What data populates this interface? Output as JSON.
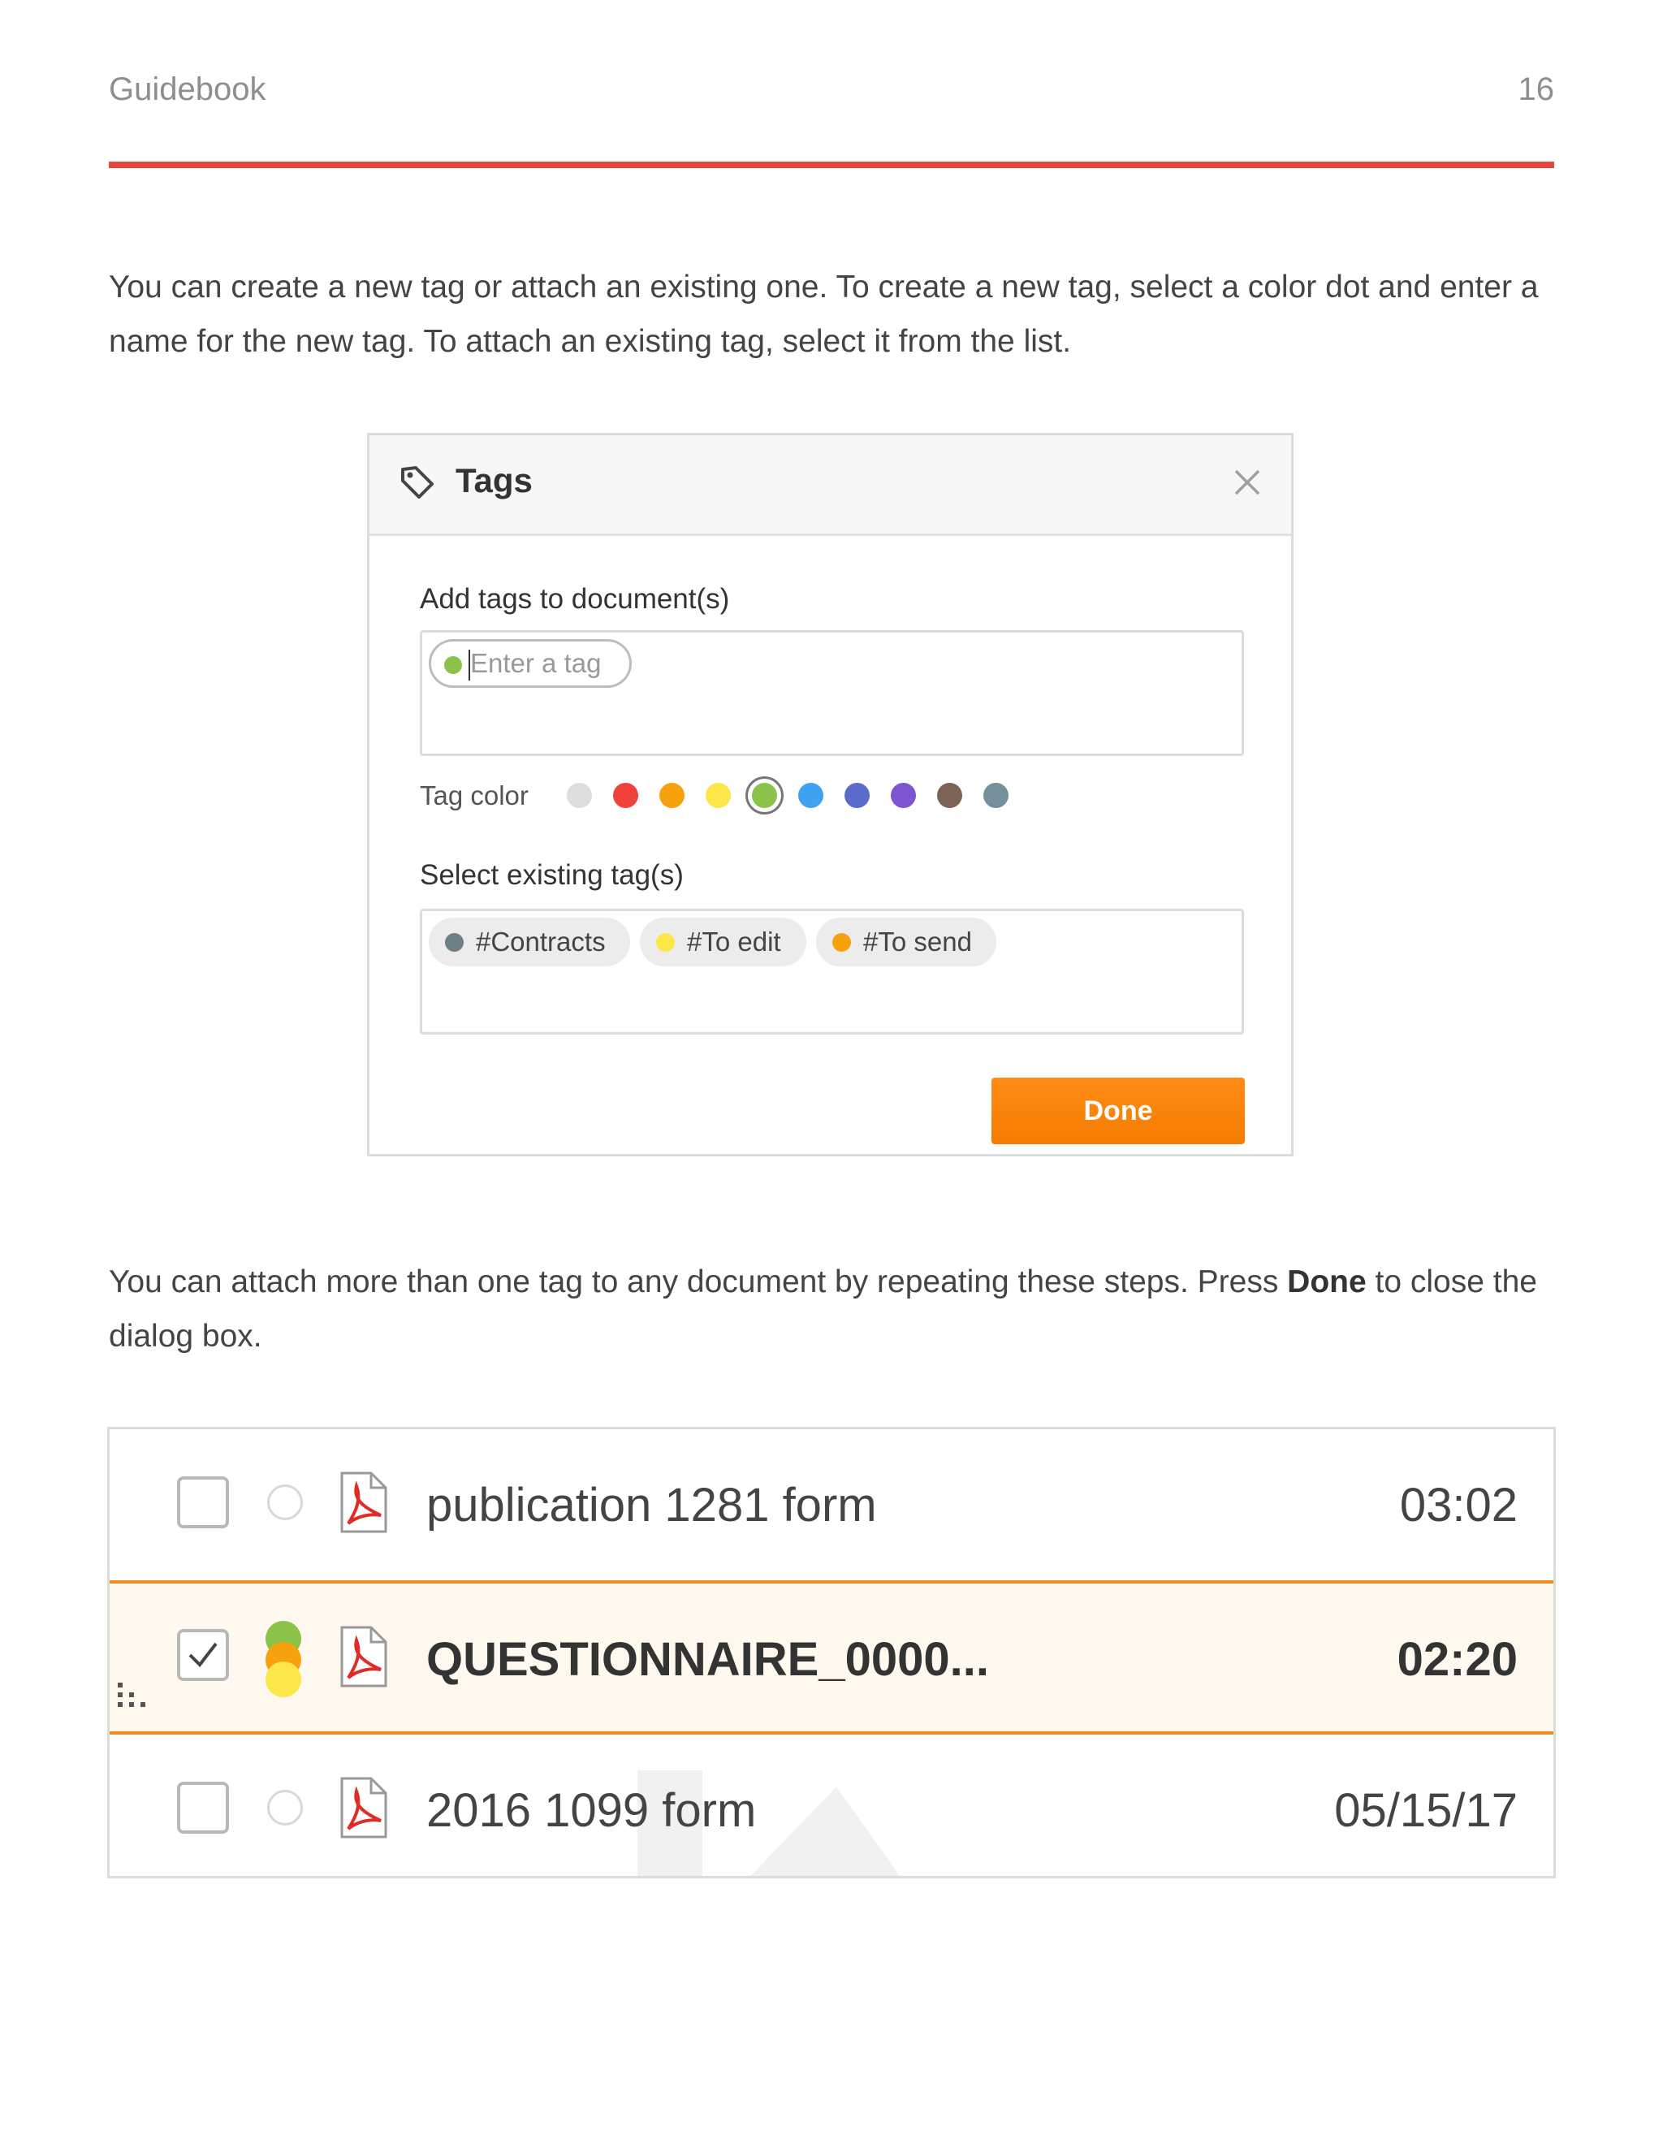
{
  "header": {
    "title": "Guidebook",
    "page_number": "16"
  },
  "paragraph1": "You can create a new tag or attach an existing one. To create a new tag, select a color dot and enter a name for the new tag. To attach an existing tag, select it from the list.",
  "paragraph2": {
    "before": "You can attach more than one tag to any document by repeating these steps. Press ",
    "bold": "Done",
    "after": " to close the dialog box."
  },
  "dialog": {
    "title": "Tags",
    "add_label": "Add tags to document(s)",
    "input_placeholder": "Enter a tag",
    "tag_color_label": "Tag color",
    "colors": [
      "#dddddd",
      "#f0413a",
      "#f7a10d",
      "#fde64a",
      "#8bc34a",
      "#3ea4f1",
      "#5a6bc9",
      "#7c55d1",
      "#7d6356",
      "#74909a"
    ],
    "selected_color_index": 4,
    "select_label": "Select existing tag(s)",
    "existing_tags": [
      {
        "label": "#Contracts",
        "color": "#6e7f88"
      },
      {
        "label": "#To edit",
        "color": "#fde64a"
      },
      {
        "label": "#To send",
        "color": "#f7a10d"
      }
    ],
    "done_label": "Done"
  },
  "files": [
    {
      "name": "publication 1281 form",
      "time": "03:02",
      "checked": false,
      "selected": false
    },
    {
      "name": "QUESTIONNAIRE_0000...",
      "time": "02:20",
      "checked": true,
      "selected": true,
      "tag_colors": [
        "#8bc34a",
        "#f7a10d",
        "#fde64a"
      ]
    },
    {
      "name": "2016 1099 form",
      "time": "05/15/17",
      "checked": false,
      "selected": false
    }
  ],
  "accent_color": "#e2483b",
  "button_color": "#f57c00"
}
